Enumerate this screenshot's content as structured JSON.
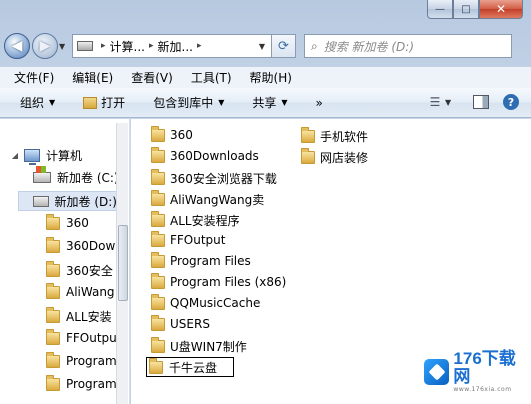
{
  "window": {
    "caption": {
      "minimize": "—",
      "maximize": "□",
      "close": "✕"
    }
  },
  "nav": {
    "back_icon": "back-arrow-icon",
    "forward_icon": "forward-arrow-icon",
    "address": {
      "crumbs": [
        "计算...",
        "新加..."
      ],
      "separator": "▸"
    },
    "refresh_icon": "refresh-icon",
    "search_placeholder": "搜索 新加卷 (D:)"
  },
  "menu": [
    "文件(F)",
    "编辑(E)",
    "查看(V)",
    "工具(T)",
    "帮助(H)"
  ],
  "commands": {
    "organize": "组织",
    "open": "打开",
    "include_in_library": "包含到库中",
    "share": "共享",
    "more": "»"
  },
  "sidebar": {
    "computer": "计算机",
    "drive_c": "新加卷 (C:)",
    "drive_d": "新加卷 (D:)",
    "folders": [
      "360",
      "360Dow",
      "360安全",
      "AliWang",
      "ALL安装",
      "FFOutpu",
      "Program",
      "Program"
    ]
  },
  "files": {
    "column1": [
      "360",
      "360Downloads",
      "360安全浏览器下载",
      "AliWangWang卖",
      "ALL安装程序",
      "FFOutput",
      "Program Files",
      "Program Files (x86)",
      "QQMusicCache",
      "USERS",
      "U盘WIN7制作"
    ],
    "column2": [
      "手机软件",
      "网店装修"
    ],
    "renaming_value": "千牛云盘"
  },
  "watermark": {
    "main": "176下载网",
    "sub": "www.176xia.com"
  }
}
